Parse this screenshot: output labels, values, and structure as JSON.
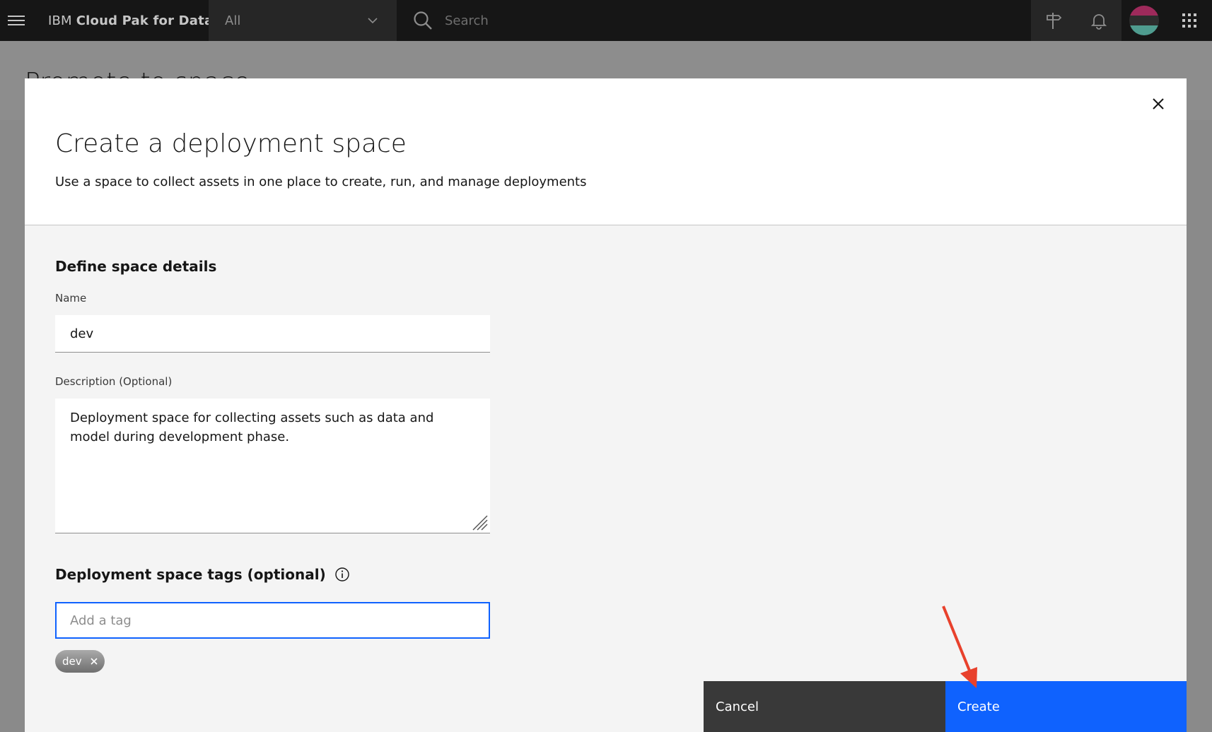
{
  "header": {
    "brand_prefix": "IBM ",
    "brand_name": "Cloud Pak for Data",
    "scope_label": "All",
    "search_placeholder": "Search"
  },
  "background": {
    "page_title": "Promote to space"
  },
  "modal": {
    "title": "Create a deployment space",
    "subtitle": "Use a space to collect assets in one place to create, run, and manage deployments",
    "section_title": "Define space details",
    "name_label": "Name",
    "name_value": "dev",
    "description_label": "Description (Optional)",
    "description_value": "Deployment space for collecting assets such as data and model during development phase.",
    "tags_title": "Deployment space tags (optional)",
    "tag_placeholder": "Add a tag",
    "tags": [
      "dev"
    ],
    "cancel_label": "Cancel",
    "create_label": "Create"
  },
  "colors": {
    "primary": "#0f62fe",
    "header_bg": "#161616",
    "annotation_arrow": "#e8412c"
  }
}
